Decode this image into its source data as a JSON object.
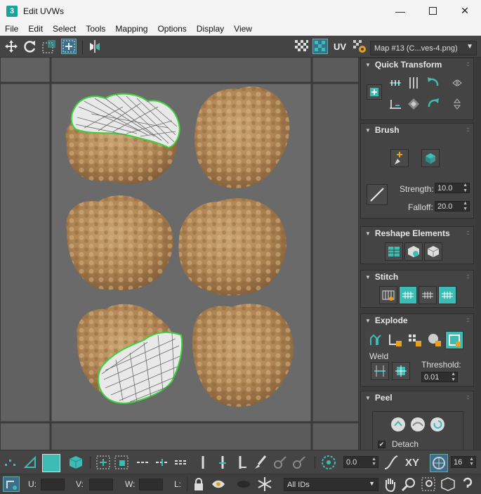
{
  "window": {
    "title": "Edit UVWs",
    "app_icon": "3",
    "buttons": [
      "minimize-icon",
      "maximize-icon",
      "close-icon"
    ]
  },
  "menu": [
    "File",
    "Edit",
    "Select",
    "Tools",
    "Mapping",
    "Options",
    "Display",
    "View"
  ],
  "toolbar": {
    "uv_label": "UV",
    "map_select": "Map #13 (C...ves-4.png)"
  },
  "panel": {
    "quick_transform": {
      "title": "Quick Transform"
    },
    "brush": {
      "title": "Brush",
      "strength_label": "Strength:",
      "strength_value": "10.0",
      "falloff_label": "Falloff:",
      "falloff_value": "20.0"
    },
    "reshape": {
      "title": "Reshape Elements"
    },
    "stitch": {
      "title": "Stitch"
    },
    "explode": {
      "title": "Explode",
      "weld_label": "Weld",
      "threshold_label": "Threshold:",
      "threshold_value": "0.01"
    },
    "peel": {
      "title": "Peel",
      "detach_label": "Detach",
      "detach_checked": true
    }
  },
  "bottom": {
    "rotation_value": "0.0",
    "xy_label": "XY",
    "snap_value": "16",
    "u_label": "U:",
    "v_label": "V:",
    "w_label": "W:",
    "l_label": "L:",
    "ids_select": "All IDs"
  },
  "colors": {
    "accent": "#3cbcb4",
    "selection": "#3cd23c",
    "panel_bg": "#444444"
  }
}
